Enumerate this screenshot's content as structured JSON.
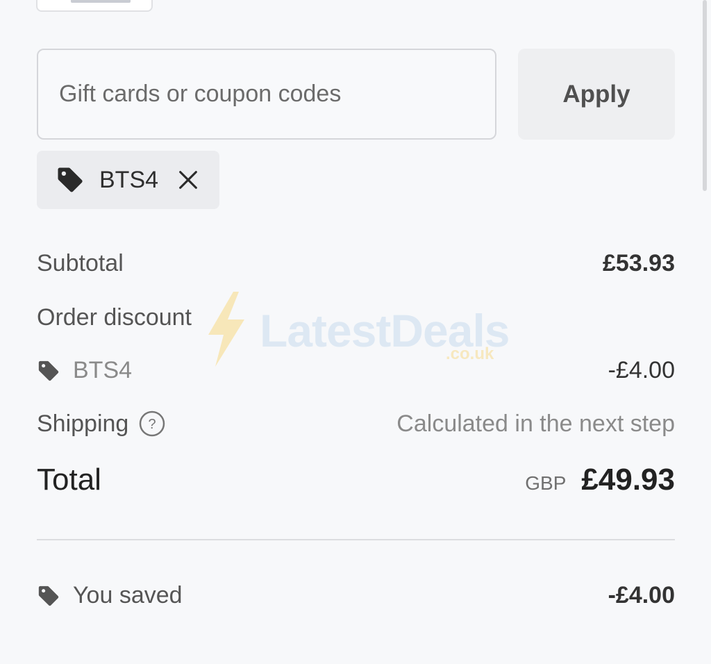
{
  "discount": {
    "input_placeholder": "Gift cards or coupon codes",
    "apply_label": "Apply",
    "applied_code": "BTS4"
  },
  "summary": {
    "subtotal_label": "Subtotal",
    "subtotal_value": "£53.93",
    "order_discount_label": "Order discount",
    "discount_code": "BTS4",
    "discount_value": "-£4.00",
    "shipping_label": "Shipping",
    "shipping_value": "Calculated in the next step",
    "total_label": "Total",
    "currency": "GBP",
    "total_value": "£49.93",
    "saved_label": "You saved",
    "saved_value": "-£4.00"
  },
  "watermark": {
    "name": "LatestDeals",
    "domain": ".co.uk"
  },
  "colors": {
    "background": "#f7f8fa",
    "apply_bg": "#eeeff1",
    "chip_bg": "#ebecef"
  }
}
